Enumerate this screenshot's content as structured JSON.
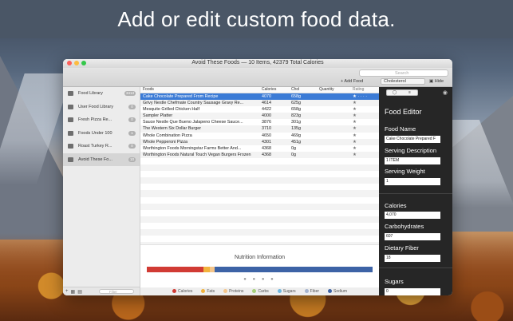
{
  "headline": "Add or edit custom food data.",
  "window": {
    "title": "Avoid These Foods — 10 Items, 42379 Total Calories",
    "search_placeholder": "Search",
    "add_food": "+ Add Food",
    "sort_value": "Cholesterol",
    "hide": "Hide"
  },
  "sidebar": {
    "items": [
      {
        "label": "Food Library",
        "badge": "3413"
      },
      {
        "label": "User Food Library",
        "badge": "0"
      },
      {
        "label": "Fresh Pizza Re...",
        "badge": "0"
      },
      {
        "label": "Foods Under 100",
        "badge": "1"
      },
      {
        "label": "Roast Turkey R...",
        "badge": "0"
      },
      {
        "label": "Avoid These Fo...",
        "badge": "10"
      }
    ],
    "filter_placeholder": "Filter"
  },
  "table": {
    "headers": {
      "food": "Foods",
      "calories": "Calories",
      "chol": "Chol",
      "qty": "Quantity",
      "rating": "Rating"
    },
    "rows": [
      {
        "food": "Cake Chocolate Prepared From Recipe",
        "calories": "4070",
        "chol": "658g",
        "rating": "★ · · · ·"
      },
      {
        "food": "Grivy Nestle Chefmate Country Sausage Gravy Re...",
        "calories": "4614",
        "chol": "625g",
        "rating": "★"
      },
      {
        "food": "Mesquite Grilled Chicken Half",
        "calories": "4422",
        "chol": "658g",
        "rating": "★"
      },
      {
        "food": "Sampler Platter",
        "calories": "4000",
        "chol": "823g",
        "rating": "★"
      },
      {
        "food": "Sauce Nestle Que Bueno Jalapeno Cheese Sauce...",
        "calories": "3876",
        "chol": "301g",
        "rating": "★"
      },
      {
        "food": "The Western Six Dollar Burger",
        "calories": "3710",
        "chol": "135g",
        "rating": "★"
      },
      {
        "food": "Whole Combination Pizza",
        "calories": "4650",
        "chol": "469g",
        "rating": "★"
      },
      {
        "food": "Whole Pepperoni Pizza",
        "calories": "4301",
        "chol": "451g",
        "rating": "★"
      },
      {
        "food": "Worthington Foods Morningstar Farms Better And...",
        "calories": "4368",
        "chol": "0g",
        "rating": "★"
      },
      {
        "food": "Worthington Foods Natural Touch Vegan Burgers Frozen",
        "calories": "4368",
        "chol": "0g",
        "rating": "★"
      }
    ]
  },
  "nutrition": {
    "title": "Nutrition Information",
    "dots": "● ● ● ●",
    "bar": [
      {
        "name": "Calories",
        "fraction": 0.25,
        "color": "#d13b34"
      },
      {
        "name": "Fats",
        "fraction": 0.03,
        "color": "#f2b33d"
      },
      {
        "name": "Proteins",
        "fraction": 0.02,
        "color": "#f4c58a"
      },
      {
        "name": "Sodium",
        "fraction": 0.7,
        "color": "#3d63a6"
      }
    ],
    "legend": [
      {
        "label": "Calories",
        "color": "#d13b34"
      },
      {
        "label": "Fats",
        "color": "#f2b33d"
      },
      {
        "label": "Proteins",
        "color": "#f4c58a"
      },
      {
        "label": "Carbs",
        "color": "#a7d07b"
      },
      {
        "label": "Sugars",
        "color": "#6fb7e0"
      },
      {
        "label": "Fiber",
        "color": "#a6b5cf"
      },
      {
        "label": "Sodium",
        "color": "#3d63a6"
      }
    ]
  },
  "editor": {
    "title": "Food Editor",
    "food_name_label": "Food Name",
    "food_name_value": "Cake Chocolate Prepared F",
    "serving_desc_label": "Serving Description",
    "serving_desc_value": "1 ITEM",
    "serving_weight_label": "Serving Weight",
    "serving_weight_value": "1",
    "calories_label": "Calories",
    "calories_value": "4,070",
    "carbs_label": "Carbohydrates",
    "carbs_value": "607",
    "fiber_label": "Dietary Fiber",
    "fiber_value": "18",
    "sugars_label": "Sugars",
    "sugars_value": "0"
  }
}
